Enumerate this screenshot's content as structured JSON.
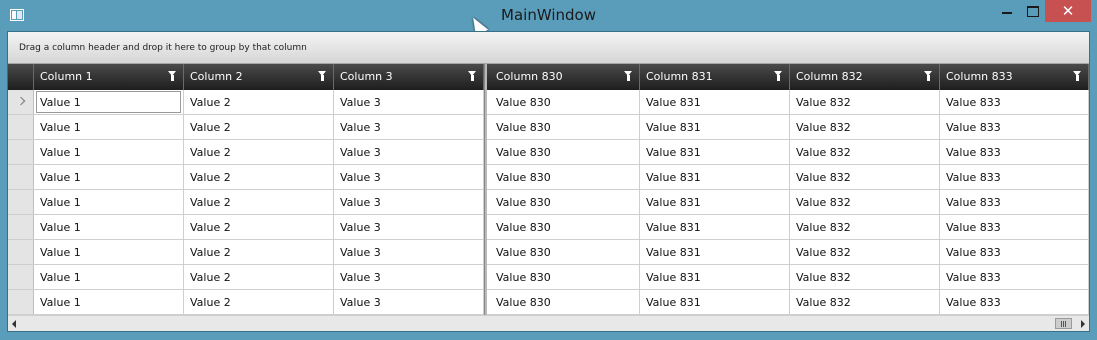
{
  "window": {
    "title": "MainWindow",
    "close_glyph": "✕",
    "icons": [
      "app-icon",
      "minimize-icon",
      "maximize-icon",
      "close-icon"
    ]
  },
  "group_panel": {
    "text": "Drag a column header and drop it here to group by that column"
  },
  "grid": {
    "columns": [
      "Column 1",
      "Column 2",
      "Column 3",
      "Column 830",
      "Column 831",
      "Column 832",
      "Column 833"
    ],
    "rows": [
      [
        "Value 1",
        "Value 2",
        "Value 3",
        "Value 830",
        "Value 831",
        "Value 832",
        "Value 833"
      ],
      [
        "Value 1",
        "Value 2",
        "Value 3",
        "Value 830",
        "Value 831",
        "Value 832",
        "Value 833"
      ],
      [
        "Value 1",
        "Value 2",
        "Value 3",
        "Value 830",
        "Value 831",
        "Value 832",
        "Value 833"
      ],
      [
        "Value 1",
        "Value 2",
        "Value 3",
        "Value 830",
        "Value 831",
        "Value 832",
        "Value 833"
      ],
      [
        "Value 1",
        "Value 2",
        "Value 3",
        "Value 830",
        "Value 831",
        "Value 832",
        "Value 833"
      ],
      [
        "Value 1",
        "Value 2",
        "Value 3",
        "Value 830",
        "Value 831",
        "Value 832",
        "Value 833"
      ],
      [
        "Value 1",
        "Value 2",
        "Value 3",
        "Value 830",
        "Value 831",
        "Value 832",
        "Value 833"
      ],
      [
        "Value 1",
        "Value 2",
        "Value 3",
        "Value 830",
        "Value 831",
        "Value 832",
        "Value 833"
      ],
      [
        "Value 1",
        "Value 2",
        "Value 3",
        "Value 830",
        "Value 831",
        "Value 832",
        "Value 833"
      ]
    ],
    "current_row": 0,
    "editing_cell": [
      0,
      0
    ]
  },
  "colors": {
    "window_frame": "#5a9dbb",
    "close_button": "#c75050",
    "header_dark": "#1e1e1e"
  }
}
